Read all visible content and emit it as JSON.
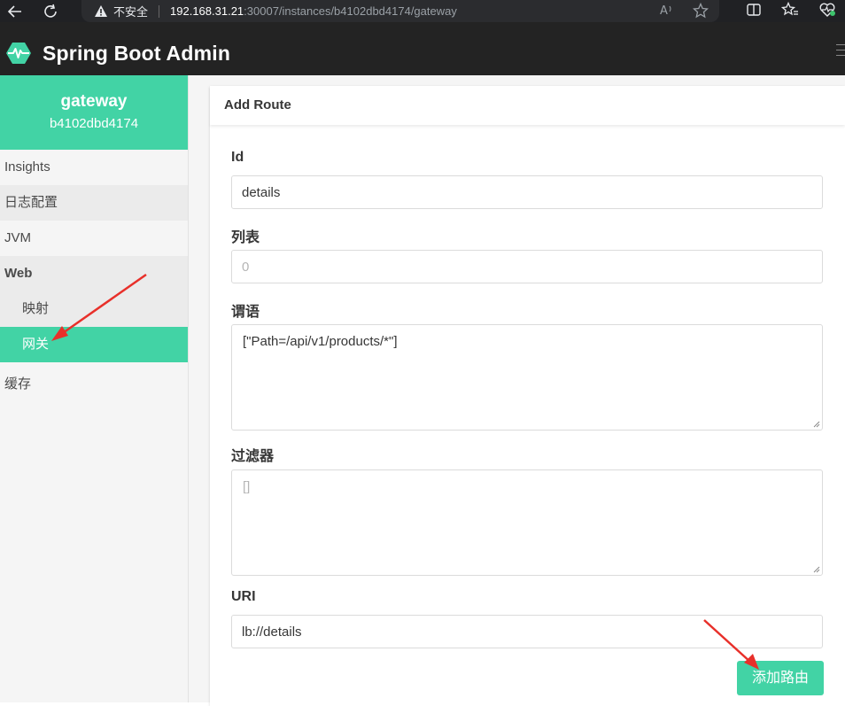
{
  "browser": {
    "security_label": "不安全",
    "url_host": "192.168.31.21",
    "url_path": ":30007/instances/b4102dbd4174/gateway"
  },
  "header": {
    "title": "Spring Boot Admin"
  },
  "sidebar": {
    "instance_name": "gateway",
    "instance_id": "b4102dbd4174",
    "items": [
      {
        "label": "Insights"
      },
      {
        "label": "日志配置"
      },
      {
        "label": "JVM"
      },
      {
        "label": "Web"
      },
      {
        "label": "映射"
      },
      {
        "label": "网关"
      },
      {
        "label": "缓存"
      }
    ]
  },
  "form": {
    "title": "Add Route",
    "id_label": "Id",
    "id_value": "details",
    "order_label": "列表",
    "order_placeholder": "0",
    "predicates_label": "谓语",
    "predicates_value": "[\"Path=/api/v1/products/*\"]",
    "filters_label": "过滤器",
    "filters_placeholder": "[]",
    "uri_label": "URI",
    "uri_value": "lb://details",
    "submit_label": "添加路由"
  },
  "colors": {
    "accent": "#42d3a5",
    "header_bg": "#232323",
    "annotation_arrow": "#e8302a"
  }
}
